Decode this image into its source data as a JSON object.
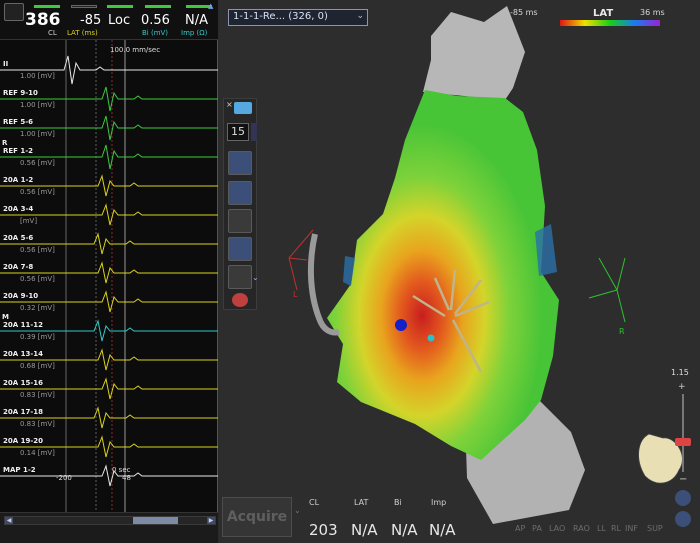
{
  "header": {
    "cl_value": "386",
    "cl_label": "CL",
    "lat_value": "-85",
    "lat_label": "LAT (ms)",
    "loc_value": "Loc",
    "bi_value": "0.56",
    "bi_label": "Bi (mV)",
    "imp_value": "N/A",
    "imp_label": "Imp (Ω)"
  },
  "ecg": {
    "speed": "100.0 mm/sec",
    "time_zero": "0 sec",
    "tick_left": "-200",
    "tick_right": "48",
    "channels": [
      {
        "label": "II",
        "scale": "1.00 [mV]",
        "color": "#e8e8e8",
        "marker": ""
      },
      {
        "label": "REF 9-10",
        "scale": "1.00 [mV]",
        "color": "#3ec93e",
        "marker": ""
      },
      {
        "label": "REF 5-6",
        "scale": "1.00 [mV]",
        "color": "#3ec93e",
        "marker": ""
      },
      {
        "label": "REF 1-2",
        "scale": "0.56 [mV]",
        "color": "#3ec93e",
        "marker": "R"
      },
      {
        "label": "20A 1-2",
        "scale": "0.56 [mV]",
        "color": "#d9d21e",
        "marker": ""
      },
      {
        "label": "20A 3-4",
        "scale": "[mV]",
        "color": "#d9d21e",
        "marker": ""
      },
      {
        "label": "20A 5-6",
        "scale": "0.56 [mV]",
        "color": "#d9d21e",
        "marker": ""
      },
      {
        "label": "20A 7-8",
        "scale": "0.56 [mV]",
        "color": "#d9d21e",
        "marker": ""
      },
      {
        "label": "20A 9-10",
        "scale": "0.32 [mV]",
        "color": "#d9d21e",
        "marker": ""
      },
      {
        "label": "20A 11-12",
        "scale": "0.39 [mV]",
        "color": "#36c8c8",
        "marker": "M"
      },
      {
        "label": "20A 13-14",
        "scale": "0.68 [mV]",
        "color": "#d9d21e",
        "marker": ""
      },
      {
        "label": "20A 15-16",
        "scale": "0.83 [mV]",
        "color": "#d9d21e",
        "marker": ""
      },
      {
        "label": "20A 17-18",
        "scale": "0.83 [mV]",
        "color": "#d9d21e",
        "marker": ""
      },
      {
        "label": "20A 19-20",
        "scale": "0.14 [mV]",
        "color": "#d9d21e",
        "marker": ""
      },
      {
        "label": "MAP 1-2",
        "scale": "",
        "color": "#e8e8e8",
        "marker": ""
      }
    ]
  },
  "map": {
    "selector_label": "1-1-1-Re... (326, 0)",
    "legend_min": "-85 ms",
    "legend_title": "LAT",
    "legend_max": "36 ms",
    "orientation_left": "L",
    "orientation_right": "R",
    "point_count": "15",
    "zoom_value": "1.15"
  },
  "bottom": {
    "acquire_label": "Acquire",
    "cl_label": "CL",
    "lat_label": "LAT",
    "bi_label": "Bi",
    "imp_label": "Imp",
    "cl_value": "203",
    "lat_value": "N/A",
    "bi_value": "N/A",
    "imp_value": "N/A",
    "views": [
      "AP",
      "PA",
      "LAO",
      "RAO",
      "LL",
      "RL",
      "INF",
      "SUP"
    ]
  },
  "colors": {
    "accent_green": "#3ec93e",
    "accent_yellow": "#d9d21e",
    "accent_cyan": "#36c8c8",
    "map_green": "#5ac838",
    "map_red": "#d9361e",
    "mesh_gray": "#b4b4b4"
  }
}
